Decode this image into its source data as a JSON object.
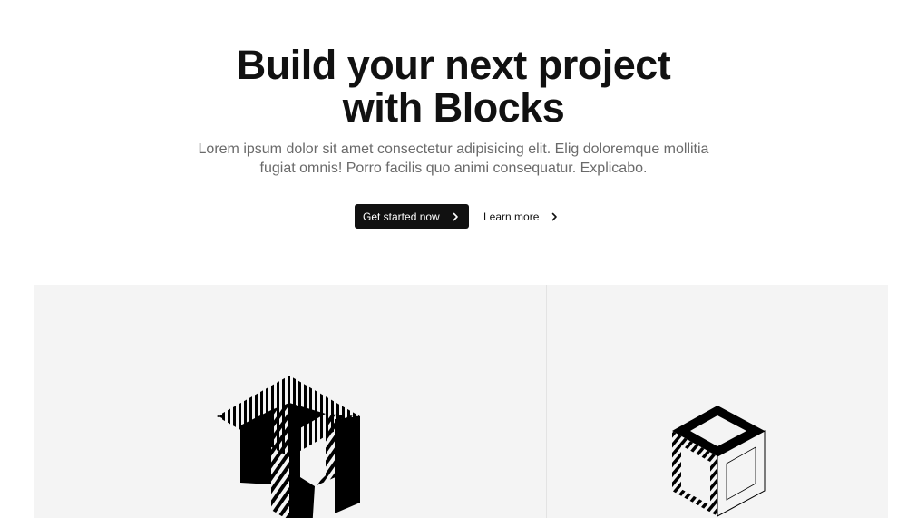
{
  "hero": {
    "title_line1": "Build your next project",
    "title_line2": "with Blocks",
    "subtitle_line1": "Lorem ipsum dolor sit amet consectetur adipisicing elit. Elig doloremque mollitia",
    "subtitle_line2": "fugiat omnis! Porro facilis quo animi consequatur. Explicabo."
  },
  "cta": {
    "primary_label": "Get started now",
    "primary_icon": "chevron-right-icon",
    "secondary_label": "Learn more",
    "secondary_icon": "chevron-right-icon"
  },
  "colors": {
    "primary_button_bg": "#111111",
    "panel_bg": "#f4f4f4",
    "subtitle_text": "#6a6a6a"
  },
  "panels": {
    "left_illustration": "striped-hexagon-block-icon",
    "right_illustration": "isometric-cube-icon"
  }
}
